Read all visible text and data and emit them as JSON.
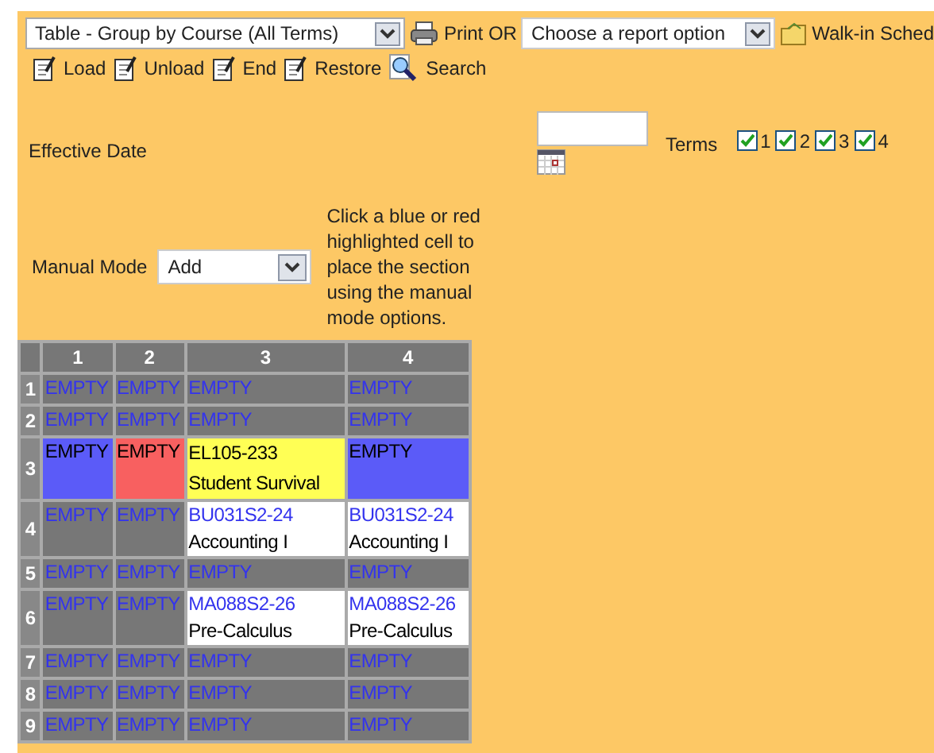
{
  "toolbar": {
    "view_select": "Table - Group by Course (All Terms)",
    "print_label": "Print OR",
    "report_select": "Choose a report option",
    "walkin_label": "Walk-in Sched"
  },
  "actions": [
    {
      "label": "Load",
      "kind": "note"
    },
    {
      "label": "Unload",
      "kind": "note"
    },
    {
      "label": "End",
      "kind": "note"
    },
    {
      "label": "Restore",
      "kind": "note"
    },
    {
      "label": "Search",
      "kind": "search"
    }
  ],
  "effective_date": {
    "label": "Effective Date"
  },
  "terms": {
    "label": "Terms",
    "options": [
      {
        "label": "1",
        "checked": true
      },
      {
        "label": "2",
        "checked": true
      },
      {
        "label": "3",
        "checked": true
      },
      {
        "label": "4",
        "checked": true
      }
    ]
  },
  "manual_mode": {
    "label": "Manual Mode",
    "value": "Add",
    "help": "Click a blue or red highlighted cell to place the section using the manual mode options."
  },
  "grid": {
    "columns": [
      "1",
      "2",
      "3",
      "4"
    ],
    "rows": [
      {
        "label": "1",
        "cells": [
          {
            "kind": "empty",
            "lines": [
              "EMPTY"
            ]
          },
          {
            "kind": "empty",
            "lines": [
              "EMPTY"
            ]
          },
          {
            "kind": "empty",
            "lines": [
              "EMPTY"
            ]
          },
          {
            "kind": "empty",
            "lines": [
              "EMPTY"
            ]
          }
        ]
      },
      {
        "label": "2",
        "cells": [
          {
            "kind": "empty",
            "lines": [
              "EMPTY"
            ]
          },
          {
            "kind": "empty",
            "lines": [
              "EMPTY"
            ]
          },
          {
            "kind": "empty",
            "lines": [
              "EMPTY"
            ]
          },
          {
            "kind": "empty",
            "lines": [
              "EMPTY"
            ]
          }
        ]
      },
      {
        "label": "3",
        "cells": [
          {
            "kind": "blue",
            "lines": [
              "EMPTY"
            ]
          },
          {
            "kind": "red",
            "lines": [
              "EMPTY"
            ]
          },
          {
            "kind": "yellow",
            "lines": [
              "EL105-233",
              "Student Survival"
            ]
          },
          {
            "kind": "blue",
            "lines": [
              "EMPTY"
            ]
          }
        ]
      },
      {
        "label": "4",
        "cells": [
          {
            "kind": "empty",
            "lines": [
              "EMPTY"
            ]
          },
          {
            "kind": "empty",
            "lines": [
              "EMPTY"
            ]
          },
          {
            "kind": "white",
            "lines": [
              "BU031S2-24",
              "Accounting I"
            ]
          },
          {
            "kind": "white",
            "lines": [
              "BU031S2-24",
              "Accounting I"
            ]
          }
        ]
      },
      {
        "label": "5",
        "cells": [
          {
            "kind": "empty",
            "lines": [
              "EMPTY"
            ]
          },
          {
            "kind": "empty",
            "lines": [
              "EMPTY"
            ]
          },
          {
            "kind": "empty",
            "lines": [
              "EMPTY"
            ]
          },
          {
            "kind": "empty",
            "lines": [
              "EMPTY"
            ]
          }
        ]
      },
      {
        "label": "6",
        "cells": [
          {
            "kind": "empty",
            "lines": [
              "EMPTY"
            ]
          },
          {
            "kind": "empty",
            "lines": [
              "EMPTY"
            ]
          },
          {
            "kind": "white",
            "lines": [
              "MA088S2-26",
              "Pre-Calculus"
            ]
          },
          {
            "kind": "white",
            "lines": [
              "MA088S2-26",
              "Pre-Calculus"
            ]
          }
        ]
      },
      {
        "label": "7",
        "cells": [
          {
            "kind": "empty",
            "lines": [
              "EMPTY"
            ]
          },
          {
            "kind": "empty",
            "lines": [
              "EMPTY"
            ]
          },
          {
            "kind": "empty",
            "lines": [
              "EMPTY"
            ]
          },
          {
            "kind": "empty",
            "lines": [
              "EMPTY"
            ]
          }
        ]
      },
      {
        "label": "8",
        "cells": [
          {
            "kind": "empty",
            "lines": [
              "EMPTY"
            ]
          },
          {
            "kind": "empty",
            "lines": [
              "EMPTY"
            ]
          },
          {
            "kind": "empty",
            "lines": [
              "EMPTY"
            ]
          },
          {
            "kind": "empty",
            "lines": [
              "EMPTY"
            ]
          }
        ]
      },
      {
        "label": "9",
        "cells": [
          {
            "kind": "empty",
            "lines": [
              "EMPTY"
            ]
          },
          {
            "kind": "empty",
            "lines": [
              "EMPTY"
            ]
          },
          {
            "kind": "empty",
            "lines": [
              "EMPTY"
            ]
          },
          {
            "kind": "empty",
            "lines": [
              "EMPTY"
            ]
          }
        ]
      }
    ]
  }
}
